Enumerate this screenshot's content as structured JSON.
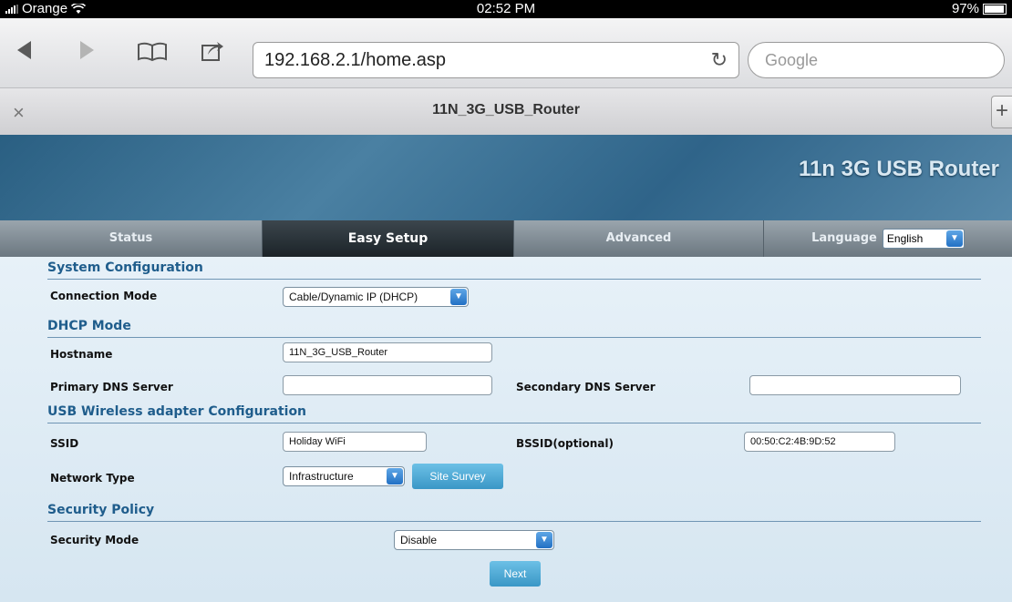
{
  "status_bar": {
    "carrier": "Orange",
    "time": "02:52 PM",
    "battery": "97%",
    "battery_level": 0.97
  },
  "browser": {
    "url": "192.168.2.1/home.asp",
    "search_placeholder": "Google",
    "tab_title": "11N_3G_USB_Router",
    "tab_close": "×",
    "new_tab": "+"
  },
  "header": {
    "brand": "11n 3G USB Router"
  },
  "nav": {
    "tabs": [
      {
        "label": "Status"
      },
      {
        "label": "Easy Setup"
      },
      {
        "label": "Advanced"
      }
    ],
    "language_label": "Language",
    "language_value": "English"
  },
  "form": {
    "system_config": {
      "title": "System Configuration",
      "connection_mode_label": "Connection Mode",
      "connection_mode_value": "Cable/Dynamic IP (DHCP)"
    },
    "dhcp": {
      "title": "DHCP Mode",
      "hostname_label": "Hostname",
      "hostname_value": "11N_3G_USB_Router",
      "primary_dns_label": "Primary DNS Server",
      "primary_dns_value": "",
      "secondary_dns_label": "Secondary DNS Server",
      "secondary_dns_value": ""
    },
    "usb_wireless": {
      "title": "USB Wireless adapter Configuration",
      "ssid_label": "SSID",
      "ssid_value": "Holiday WiFi",
      "bssid_label": "BSSID(optional)",
      "bssid_value": "00:50:C2:4B:9D:52",
      "network_type_label": "Network Type",
      "network_type_value": "Infrastructure",
      "site_survey_label": "Site Survey"
    },
    "security": {
      "title": "Security Policy",
      "security_mode_label": "Security Mode",
      "security_mode_value": "Disable"
    },
    "next_label": "Next"
  }
}
